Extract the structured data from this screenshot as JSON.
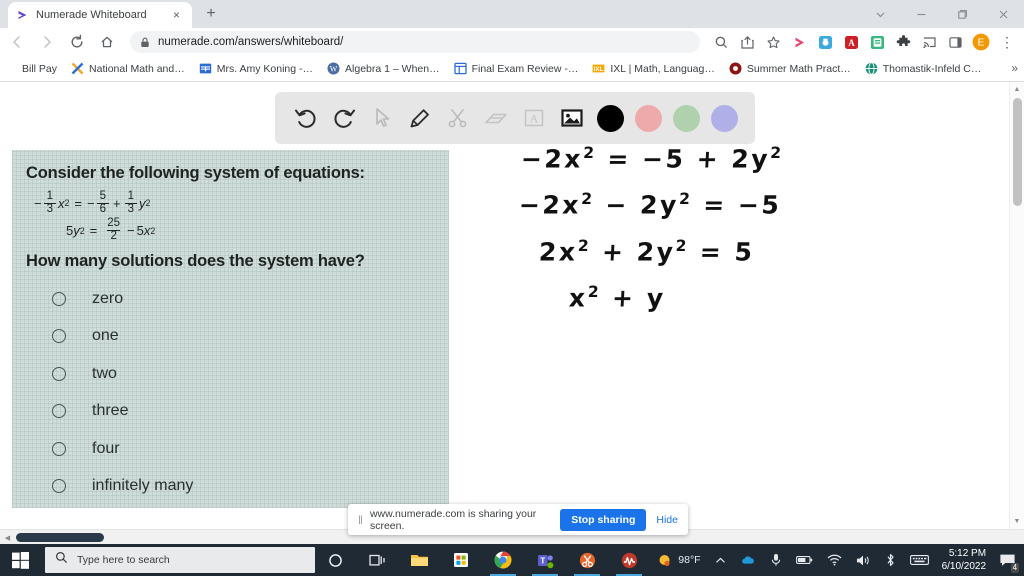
{
  "browser": {
    "tab": {
      "title": "Numerade Whiteboard",
      "favicon": "numerade-play-icon",
      "close": "×"
    },
    "new_tab_label": "+",
    "window_controls": [
      {
        "name": "tab-search",
        "glyph": "⌄"
      },
      {
        "name": "minimize",
        "glyph": "–"
      },
      {
        "name": "maximize",
        "glyph": "❐"
      },
      {
        "name": "close",
        "glyph": "✕"
      }
    ],
    "nav": {
      "back": "←",
      "forward": "→",
      "reload": "⟳",
      "home": "⌂"
    },
    "omnibox": {
      "url": "numerade.com/answers/whiteboard/",
      "lock": "lock-icon"
    },
    "toolbar_icons": [
      "search-icon",
      "share-icon",
      "bookmark-star-icon",
      "numerade-extension-icon",
      "camera-extension-icon",
      "adobe-acrobat-icon",
      "note-extension-icon",
      "extensions-puzzle-icon",
      "cast-icon",
      "side-panel-icon"
    ],
    "profile_initial": "E",
    "menu_glyph": "⋮",
    "bookmarks": [
      {
        "label": "Bill Pay",
        "icon": "none"
      },
      {
        "label": "National Math and…",
        "icon": "x-logo-icon"
      },
      {
        "label": "Mrs. Amy Koning -…",
        "icon": "table-icon"
      },
      {
        "label": "Algebra 1 – When…",
        "icon": "wordpress-icon"
      },
      {
        "label": "Final Exam Review -…",
        "icon": "frame-icon"
      },
      {
        "label": "IXL | Math, Languag…",
        "icon": "ixl-icon"
      },
      {
        "label": "Summer Math Pract…",
        "icon": "circle-icon"
      },
      {
        "label": "Thomastik-Infeld C…",
        "icon": "globe-icon"
      }
    ],
    "bookmarks_overflow": "»"
  },
  "whiteboard": {
    "tools": [
      {
        "name": "undo-icon",
        "label": "Undo"
      },
      {
        "name": "redo-icon",
        "label": "Redo"
      },
      {
        "name": "cursor-icon",
        "label": "Select"
      },
      {
        "name": "pencil-icon",
        "label": "Pencil"
      },
      {
        "name": "scissors-icon",
        "label": "Cut"
      },
      {
        "name": "eraser-icon",
        "label": "Eraser"
      },
      {
        "name": "textbox-icon",
        "label": "Text"
      },
      {
        "name": "image-icon",
        "label": "Image"
      }
    ],
    "colors": [
      {
        "name": "color-black",
        "hex": "#000000"
      },
      {
        "name": "color-pink",
        "hex": "#eeaaaa"
      },
      {
        "name": "color-green",
        "hex": "#b0d1ad"
      },
      {
        "name": "color-periwinkle",
        "hex": "#b0b0e8"
      }
    ],
    "selected_tool": "pencil-icon",
    "selected_color": "#000000"
  },
  "question": {
    "title": "Consider the following system of equations:",
    "equation_1": {
      "lhs_sign": "−",
      "lhs_frac": {
        "num": "1",
        "den": "3"
      },
      "lhs_var": "x",
      "lhs_exp": "2",
      "eq": "=",
      "rhs_sign": "−",
      "rhs_frac": {
        "num": "5",
        "den": "6"
      },
      "plus": "+",
      "rhs_frac2": {
        "num": "1",
        "den": "3"
      },
      "rhs_var": "y",
      "rhs_exp": "2"
    },
    "equation_2": {
      "lhs_coef": "5",
      "lhs_var": "y",
      "lhs_exp": "2",
      "eq": "=",
      "frac": {
        "num": "25",
        "den": "2"
      },
      "minus": "−",
      "rhs_coef": "5",
      "rhs_var": "x",
      "rhs_exp": "2"
    },
    "prompt": "How many solutions does the system have?",
    "options": [
      {
        "label": "zero",
        "selected": false
      },
      {
        "label": "one",
        "selected": false
      },
      {
        "label": "two",
        "selected": false
      },
      {
        "label": "three",
        "selected": false
      },
      {
        "label": "four",
        "selected": false
      },
      {
        "label": "infinitely many",
        "selected": false
      }
    ]
  },
  "handwriting": {
    "lines": [
      {
        "text": "−2x",
        "exp": "2",
        "rest": " = −5 + 2y",
        "exp2": "2"
      },
      {
        "text": "−2x",
        "exp": "2",
        "rest": " − 2y",
        "exp2": "2",
        "tail": " = −5"
      },
      {
        "text": "2x",
        "exp": "2",
        "rest": " + 2y",
        "exp2": "2",
        "tail": " = 5"
      },
      {
        "text": "x",
        "exp": "2",
        "rest": " + y"
      }
    ]
  },
  "share_bar": {
    "grip": "‖",
    "message": "www.numerade.com is sharing your screen.",
    "stop_label": "Stop sharing",
    "hide_label": "Hide"
  },
  "taskbar": {
    "start_icon": "windows-logo-icon",
    "search_placeholder": "Type here to search",
    "search_icon": "search-icon",
    "pinned": [
      {
        "name": "cortana-icon",
        "active": false
      },
      {
        "name": "task-view-icon",
        "active": false
      },
      {
        "name": "file-explorer-icon",
        "active": false
      },
      {
        "name": "microsoft-store-icon",
        "active": false
      },
      {
        "name": "chrome-icon",
        "active": true
      },
      {
        "name": "microsoft-teams-icon",
        "active": true
      },
      {
        "name": "snipping-tool-icon",
        "active": true
      },
      {
        "name": "audacity-icon",
        "active": true
      }
    ],
    "weather": {
      "icon": "sun-icon",
      "temperature": "98°F"
    },
    "tray": [
      {
        "name": "show-hidden-icons-icon",
        "glyph": "∧"
      },
      {
        "name": "onedrive-icon",
        "glyph": "☁"
      },
      {
        "name": "microphone-icon",
        "glyph": "Ἲ4"
      },
      {
        "name": "battery-icon",
        "glyph": "▭"
      },
      {
        "name": "wifi-icon",
        "glyph": "◠"
      },
      {
        "name": "volume-icon",
        "glyph": "ὐA"
      },
      {
        "name": "bluetooth-icon",
        "glyph": "භ"
      },
      {
        "name": "keyboard-icon",
        "glyph": "⌨"
      }
    ],
    "clock": {
      "time": "5:12 PM",
      "date": "6/10/2022"
    },
    "notifications": {
      "icon": "notification-icon",
      "count": "4"
    }
  }
}
